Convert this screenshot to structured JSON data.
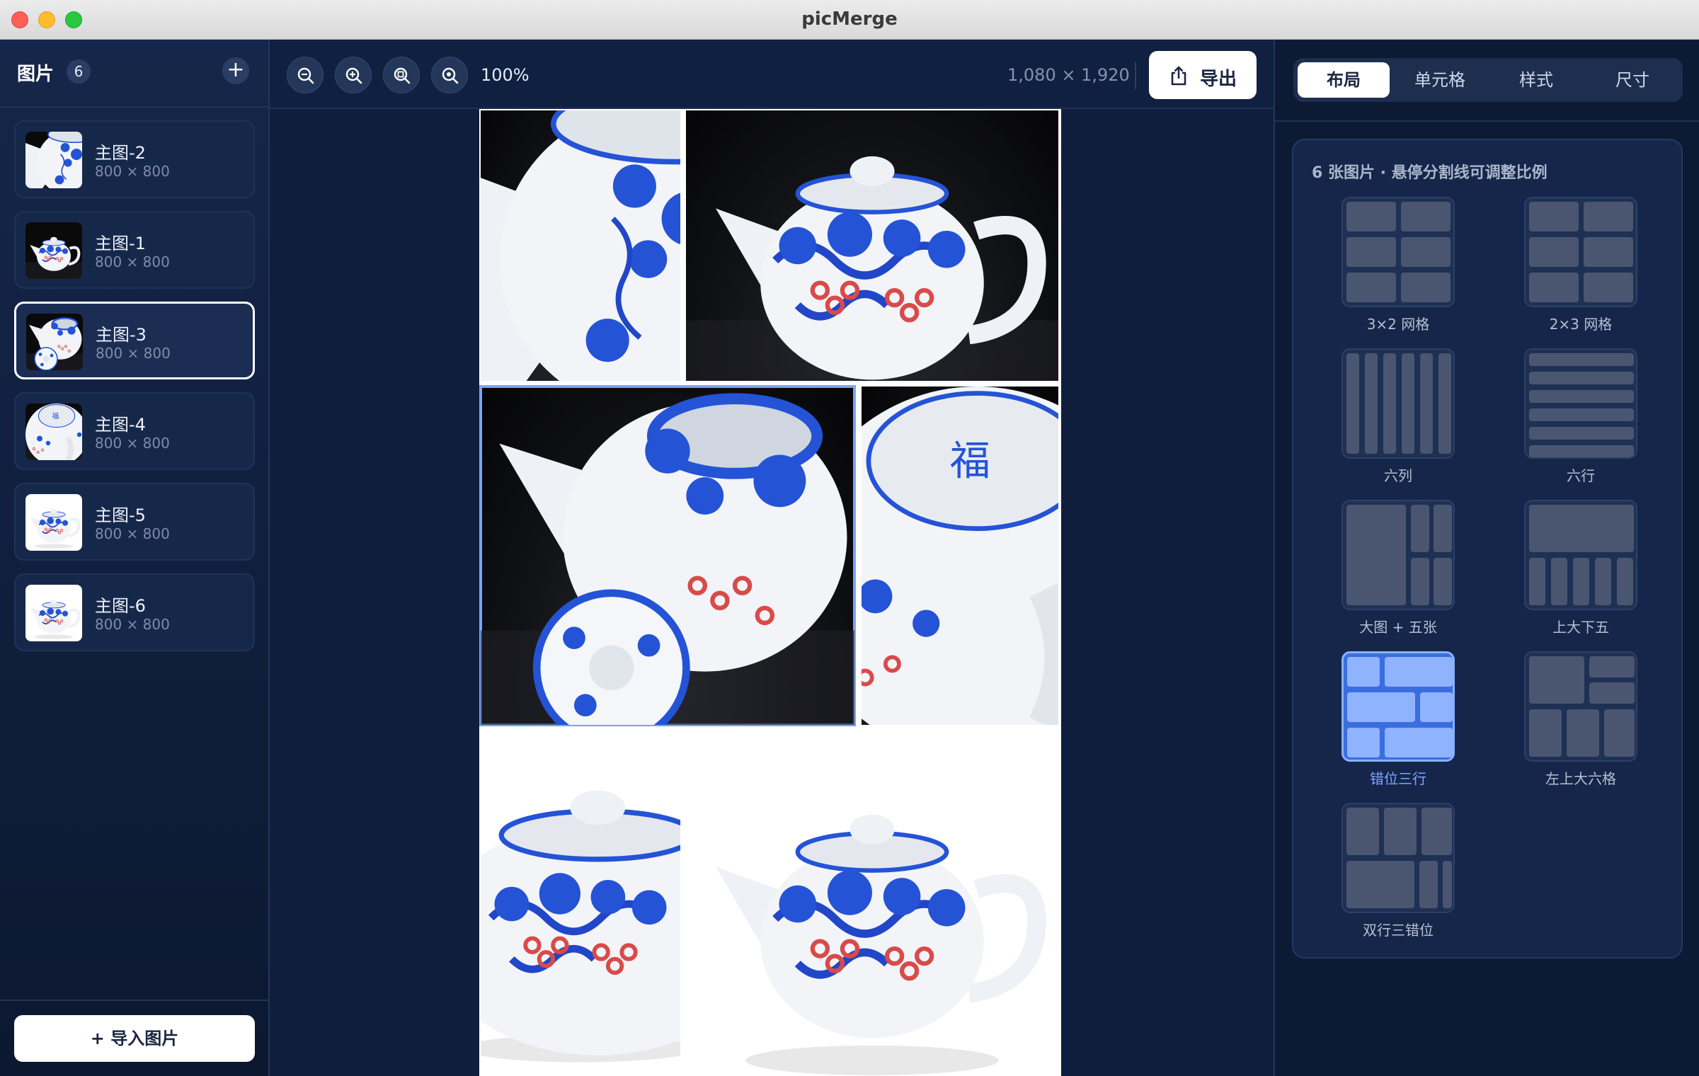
{
  "window": {
    "title": "picMerge"
  },
  "sidebar": {
    "title": "图片",
    "count": "6",
    "add_icon": "plus-icon",
    "items": [
      {
        "name": "主图-2",
        "size": "800 × 800",
        "thumb": "dark",
        "selected": false
      },
      {
        "name": "主图-1",
        "size": "800 × 800",
        "thumb": "dark",
        "selected": false
      },
      {
        "name": "主图-3",
        "size": "800 × 800",
        "thumb": "dark",
        "selected": true
      },
      {
        "name": "主图-4",
        "size": "800 × 800",
        "thumb": "dark",
        "selected": false
      },
      {
        "name": "主图-5",
        "size": "800 × 800",
        "thumb": "light",
        "selected": false
      },
      {
        "name": "主图-6",
        "size": "800 × 800",
        "thumb": "light",
        "selected": false
      }
    ],
    "import_label": "+ 导入图片"
  },
  "toolbar": {
    "zoom_icons": [
      "zoom-out-icon",
      "zoom-in-icon",
      "zoom-fit-icon",
      "zoom-reset-icon"
    ],
    "zoom_level": "100%",
    "canvas_size": "1,080 × 1,920",
    "export_label": "导出",
    "export_icon": "share-icon"
  },
  "canvas": {
    "layout": "错位三行",
    "selected_cell": 2,
    "cells": [
      {
        "image": "主图-2",
        "bg": "dark"
      },
      {
        "image": "主图-1",
        "bg": "dark"
      },
      {
        "image": "主图-3",
        "bg": "dark"
      },
      {
        "image": "主图-4",
        "bg": "dark"
      },
      {
        "image": "主图-5",
        "bg": "light"
      },
      {
        "image": "主图-6",
        "bg": "light"
      }
    ]
  },
  "right_panel": {
    "tabs": [
      "布局",
      "单元格",
      "样式",
      "尺寸"
    ],
    "active_tab": "布局",
    "hint": "6 张图片 · 悬停分割线可调整比例",
    "layouts": [
      {
        "label": "3×2 网格",
        "active": false
      },
      {
        "label": "2×3 网格",
        "active": false
      },
      {
        "label": "六列",
        "active": false
      },
      {
        "label": "六行",
        "active": false
      },
      {
        "label": "大图 + 五张",
        "active": false
      },
      {
        "label": "上大下五",
        "active": false
      },
      {
        "label": "错位三行",
        "active": true
      },
      {
        "label": "左上大六格",
        "active": false
      },
      {
        "label": "双行三错位",
        "active": false
      }
    ]
  },
  "colors": {
    "background": "#0e1a33",
    "accent": "#7ea6ff",
    "active_layout": "#3a6de0",
    "selection_outline": "#7aa4f5"
  }
}
